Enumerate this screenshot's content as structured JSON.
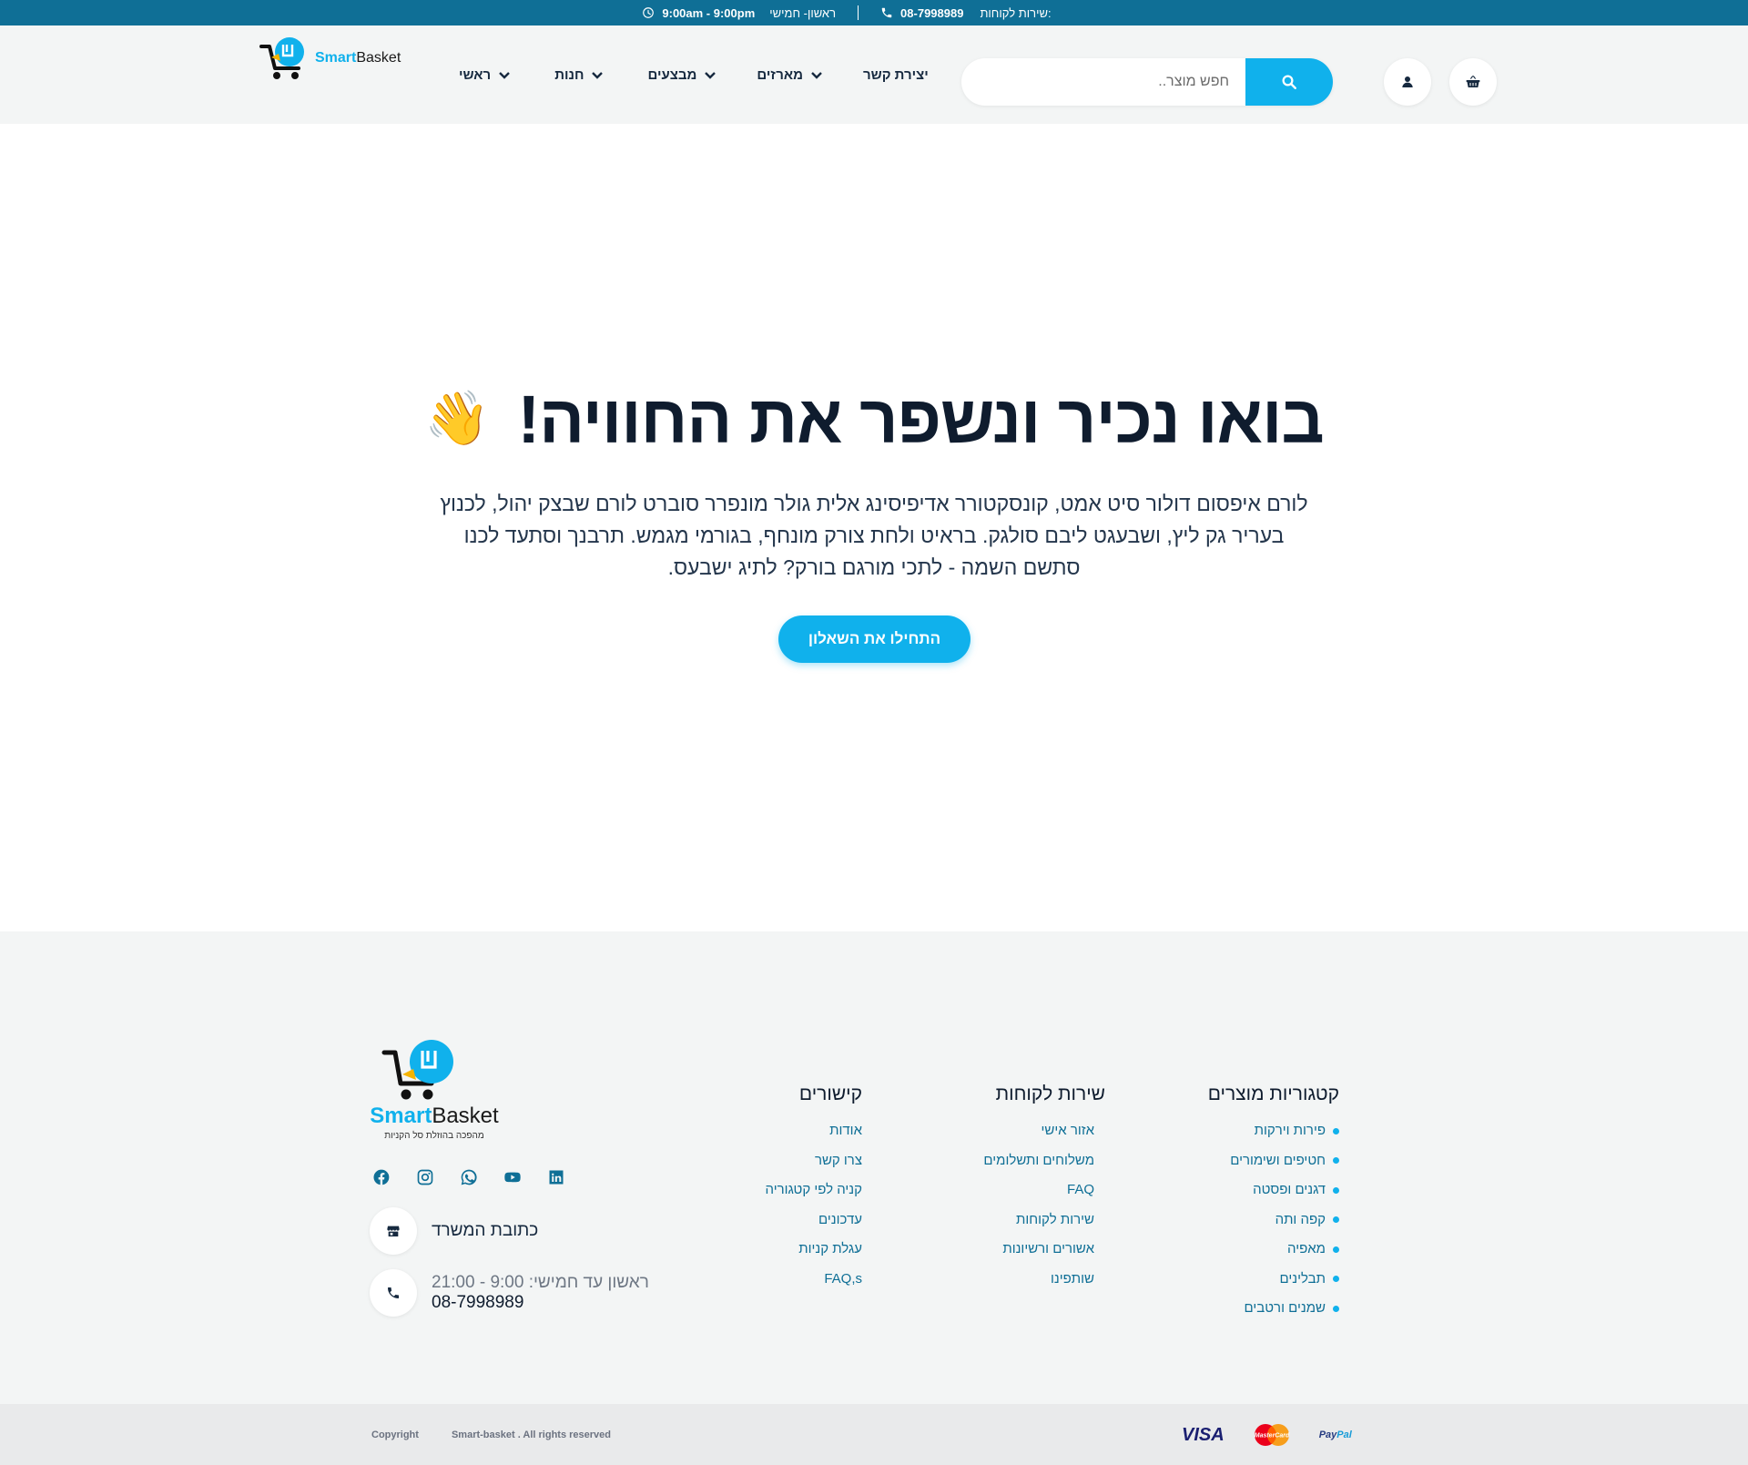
{
  "colors": {
    "topbar": "#0f6f96",
    "accent": "#10b1ec",
    "dark": "#0f1c2e",
    "footer_bg": "#f3f5f5",
    "bottombar_bg": "#e9eaeb"
  },
  "topbar": {
    "service_label": "שירות לקוחות:",
    "phone": "08-7998989",
    "days": "ראשון- חמישי",
    "hours": "9:00am - 9:00pm"
  },
  "header": {
    "logo_brand_smart": "Smart",
    "logo_brand_basket": "Basket",
    "nav": [
      {
        "label": "ראשי",
        "has_dropdown": true
      },
      {
        "label": "חנות",
        "has_dropdown": true
      },
      {
        "label": "מבצעים",
        "has_dropdown": true
      },
      {
        "label": "מארזים",
        "has_dropdown": true
      },
      {
        "label": "יצירת קשר",
        "has_dropdown": false
      }
    ],
    "search_placeholder": "חפש מוצר..",
    "icons": {
      "search": "search-icon",
      "account": "user-icon",
      "cart": "basket-icon"
    }
  },
  "hero": {
    "title": "בואו נכיר ונשפר את החוויה!",
    "emoji": "👋",
    "text": "לורם איפסום דולור סיט אמט, קונסקטורר אדיפיסינג אלית גולר מונפרר סוברט לורם שבצק יהול, לכנוץ בעריר גק ליץ, ושבעגט ליבם סולגק. בראיט ולחת צורק מונחף, בגורמי מגמש. תרבנך וסתעד לכנו סתשם השמה - לתכי מורגם בורק? לתיג ישבעס.",
    "cta": "התחילו את השאלון"
  },
  "footer": {
    "logo_brand_smart": "Smart",
    "logo_brand_basket": "Basket",
    "tagline": "מהפכה בהוזלת סל הקניות",
    "socials": [
      "facebook-icon",
      "instagram-icon",
      "whatsapp-icon",
      "youtube-icon",
      "linkedin-icon"
    ],
    "office_address_label": "כתובת המשרד",
    "hours_text": "ראשון עד חמישי: 9:00 - 21:00",
    "phone": "08-7998989",
    "columns": {
      "categories": {
        "title": "קטגוריות מוצרים",
        "items": [
          "פירות וירקות",
          "חטיפים ושימורים",
          "דגנים ופסטה",
          "קפה ותה",
          "מאפיה",
          "תבלינים",
          "שמנים ורטבים"
        ]
      },
      "service": {
        "title": "שירות לקוחות",
        "items": [
          "אזור אישי",
          "משלוחים ותשלומים",
          "FAQ",
          "שירות לקוחות",
          "אשורים ורשיונות",
          "שותפינו"
        ]
      },
      "links": {
        "title": "קישורים",
        "items": [
          "אודות",
          "צרו קשר",
          "קניה לפי קטגוריה",
          "עדכונים",
          "עגלת קניות",
          "FAQ,s"
        ]
      }
    }
  },
  "bottombar": {
    "copyright": "Copyright",
    "rights": "Smart-basket . All rights reserved",
    "payments": {
      "visa": "VISA",
      "mastercard": "MasterCard",
      "paypal_a": "Pay",
      "paypal_b": "Pal"
    }
  }
}
